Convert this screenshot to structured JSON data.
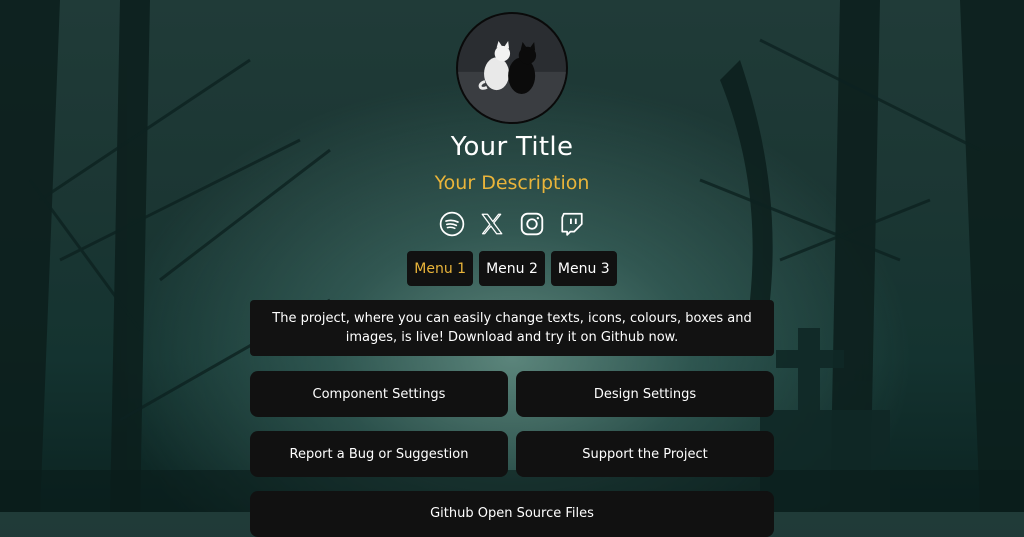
{
  "profile": {
    "title": "Your Title",
    "description": "Your Description"
  },
  "socials": [
    {
      "icon": "spotify-icon"
    },
    {
      "icon": "x-icon"
    },
    {
      "icon": "instagram-icon"
    },
    {
      "icon": "twitch-icon"
    }
  ],
  "menu": {
    "items": [
      "Menu 1",
      "Menu 2",
      "Menu 3"
    ],
    "active_index": 0
  },
  "info_text": "The project, where you can easily change texts, icons, colours, boxes and images, is live! Download and try it on Github now.",
  "links": [
    "Component Settings",
    "Design Settings",
    "Report a Bug or Suggestion",
    "Support the Project",
    "Github Open Source Files"
  ],
  "colors": {
    "accent": "#e9b43a",
    "card": "#111111",
    "text": "#ffffff"
  }
}
